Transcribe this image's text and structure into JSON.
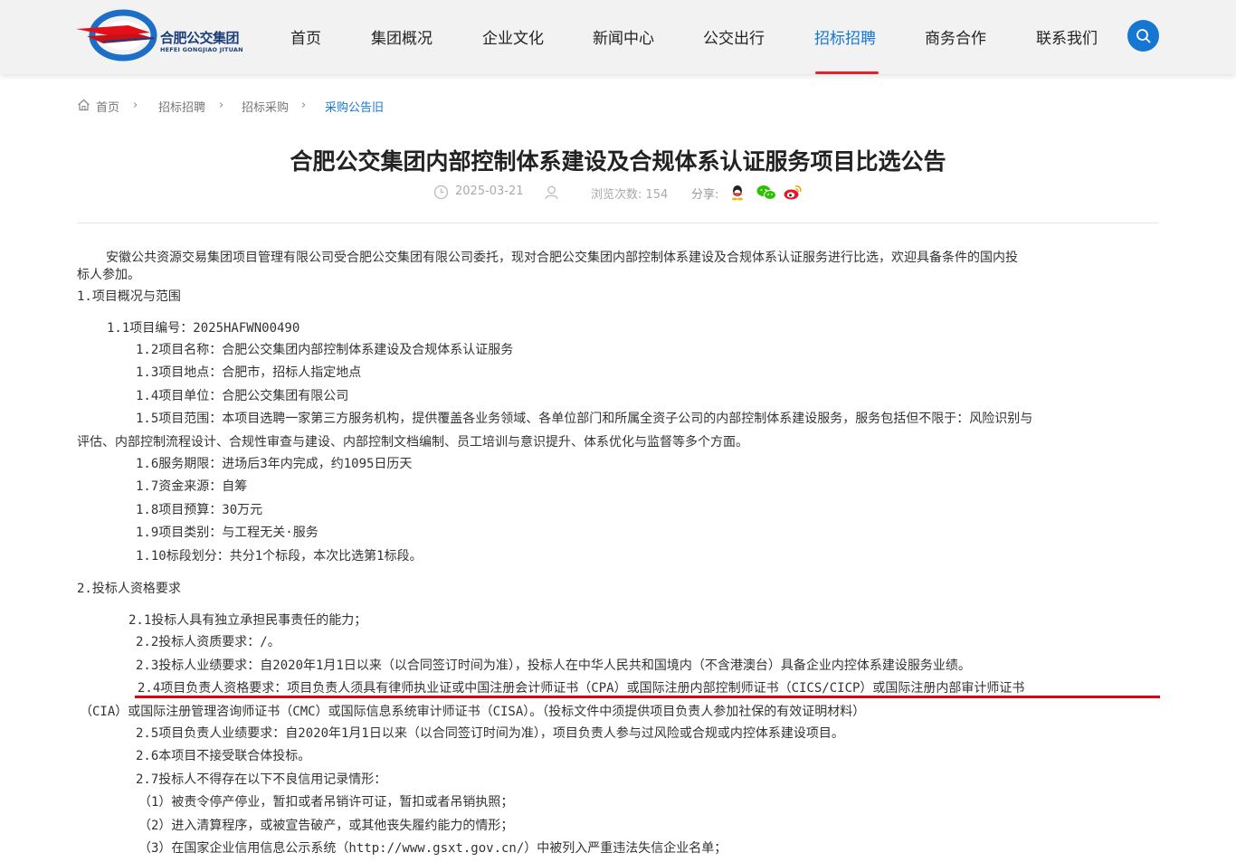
{
  "header": {
    "logo_cn": "合肥公交集团",
    "logo_en": "HEFEI GONGJIAO JITUAN",
    "nav": [
      "首页",
      "集团概况",
      "企业文化",
      "新闻中心",
      "公交出行",
      "招标招聘",
      "商务合作",
      "联系我们"
    ],
    "active_nav": "招标招聘",
    "search_icon": "search-icon"
  },
  "breadcrumb": {
    "home": "首页",
    "level1": "招标招聘",
    "level2": "招标采购",
    "current": "采购公告旧"
  },
  "article": {
    "title": "合肥公交集团内部控制体系建设及合规体系认证服务项目比选公告",
    "date": "2025-03-21",
    "views_label": "浏览次数: 154",
    "share_label": "分享:",
    "paragraphs": [
      "安徽公共资源交易集团项目管理有限公司受合肥公交集团有限公司委托，现对合肥公交集团内部控制体系建设及合规体系认证服务进行比选，欢迎具备条件的国内投",
      "标人参加。",
      "1.项目概况与范围",
      "1.1项目编号：2025HAFWN00490",
      "1.2项目名称：合肥公交集团内部控制体系建设及合规体系认证服务",
      "1.3项目地点：合肥市，招标人指定地点",
      "1.4项目单位：合肥公交集团有限公司",
      "1.5项目范围：本项目选聘一家第三方服务机构，提供覆盖各业务领域、各单位部门和所属全资子公司的内部控制体系建设服务，服务包括但不限于：风险识别与",
      "评估、内部控制流程设计、合规性审查与建设、内部控制文档编制、员工培训与意识提升、体系优化与监督等多个方面。",
      "1.6服务期限：进场后3年内完成，约1095日历天",
      "1.7资金来源：自筹",
      "1.8项目预算：30万元",
      "1.9项目类别：与工程无关·服务",
      "1.10标段划分：共分1个标段，本次比选第1标段。",
      "2.投标人资格要求",
      "2.1投标人具有独立承担民事责任的能力；",
      "2.2投标人资质要求：/。",
      "2.3投标人业绩要求：自2020年1月1日以来（以合同签订时间为准），投标人在中华人民共和国境内（不含港澳台）具备企业内控体系建设服务业绩。",
      "2.4项目负责人资格要求：项目负责人须具有律师执业证或中国注册会计师证书（CPA）或国际注册内部控制师证书（CICS/CICP）或国际注册内部审计师证书",
      "（CIA）或国际注册管理咨询师证书（CMC）或国际信息系统审计师证书（CISA）。（投标文件中须提供项目负责人参加社保的有效证明材料）",
      "2.5项目负责人业绩要求：自2020年1月1日以来（以合同签订时间为准），项目负责人参与过风险或合规或内控体系建设项目。",
      "2.6本项目不接受联合体投标。",
      "2.7投标人不得存在以下不良信用记录情形：",
      "（1）被责令停产停业，暂扣或者吊销许可证，暂扣或者吊销执照；",
      "（2）进入清算程序，或被宣告破产，或其他丧失履约能力的情形；",
      "（3）在国家企业信用信息公示系统（http://www.gsxt.gov.cn/）中被列入严重违法失信企业名单；"
    ]
  },
  "colors": {
    "accent": "#1677d2",
    "highlight_line": "#e3000f",
    "header_bg": "#f2f2f2"
  }
}
